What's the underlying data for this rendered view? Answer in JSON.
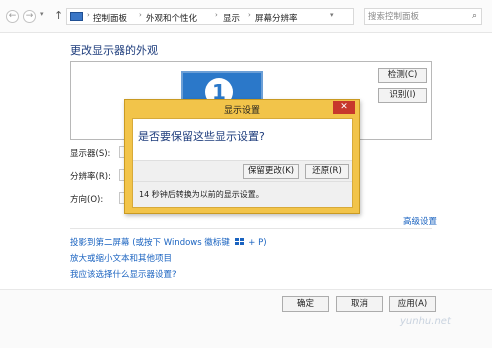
{
  "address_bar": {
    "back_icon": "back-arrow-icon",
    "forward_icon": "forward-arrow-icon",
    "up_icon": "up-arrow-icon",
    "breadcrumbs": [
      "控制面板",
      "外观和个性化",
      "显示",
      "屏幕分辨率"
    ],
    "search_placeholder": "搜索控制面板"
  },
  "page_title": "更改显示器的外观",
  "preview": {
    "monitor_number": "1",
    "detect_label": "检测(C)",
    "identify_label": "识别(I)"
  },
  "form": {
    "display_label": "显示器(S):",
    "resolution_label": "分辨率(R):",
    "orientation_label": "方向(O):"
  },
  "advanced_link": "高级设置",
  "links": {
    "project_prefix": "投影到第二屏幕 (或按下 Windows 徽标键",
    "project_suffix": "+ P)",
    "enlarge": "放大或缩小文本和其他项目",
    "which_settings": "我应该选择什么显示器设置?"
  },
  "footer": {
    "ok_label": "确定",
    "cancel_label": "取消",
    "apply_label": "应用(A)"
  },
  "dialog": {
    "title": "显示设置",
    "close_glyph": "✕",
    "question": "是否要保留这些显示设置?",
    "keep_label": "保留更改(K)",
    "revert_label": "还原(R)",
    "countdown": "14 秒钟后转换为以前的显示设置。"
  },
  "watermark": "yunhu.net",
  "colors": {
    "dialog_frame": "#f2c44a",
    "close_button": "#c7382c",
    "link": "#1a63c0",
    "title": "#1d3c7c",
    "monitor": "#2b78c9"
  }
}
